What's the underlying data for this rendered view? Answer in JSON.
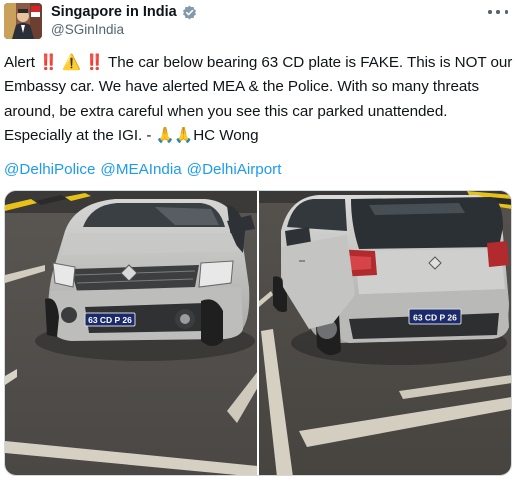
{
  "tweet": {
    "display_name": "Singapore in India",
    "handle": "@SGinIndia",
    "more_icon": "more-horizontal-icon",
    "verified_icon": "verified-badge-icon",
    "text_segments": [
      {
        "type": "text",
        "value": "Alert "
      },
      {
        "type": "emoji",
        "value": "‼️"
      },
      {
        "type": "text",
        "value": " "
      },
      {
        "type": "emoji",
        "value": "⚠️"
      },
      {
        "type": "text",
        "value": " "
      },
      {
        "type": "emoji",
        "value": "‼️"
      },
      {
        "type": "text",
        "value": " The car below bearing 63 CD plate is FAKE. This is NOT our Embassy car. We have alerted MEA & the Police. With so many threats around, be extra careful when you see this car parked unattended. Especially at the IGI. - "
      },
      {
        "type": "emoji",
        "value": "🙏🙏"
      },
      {
        "type": "text",
        "value": "HC Wong"
      }
    ],
    "mentions": [
      "@DelhiPolice",
      "@MEAIndia",
      "@DelhiAirport"
    ],
    "photos": [
      {
        "plate": "63 CD P 26",
        "brand_badge": "RENAULT",
        "view": "front"
      },
      {
        "plate": "63 CD P 26",
        "brand_badge": "RENAULT",
        "view": "rear"
      }
    ],
    "colors": {
      "link": "#1d9bf0",
      "text": "#0f1419",
      "secondary": "#536471",
      "verified": "#829aab",
      "plate_bg": "#1b2a6b"
    }
  }
}
